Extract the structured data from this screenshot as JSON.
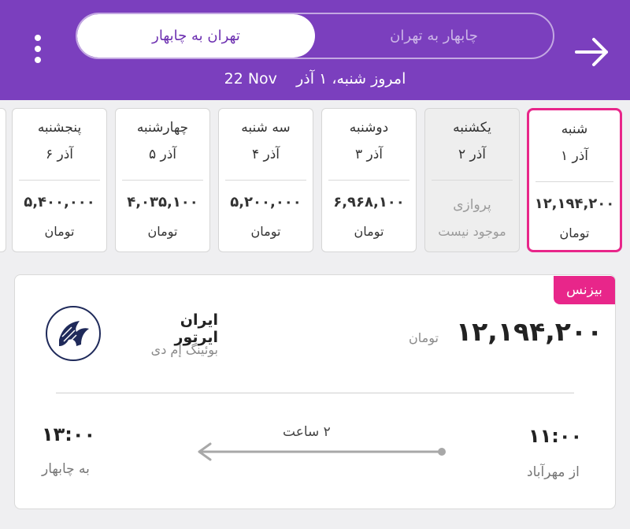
{
  "header": {
    "tabs": [
      {
        "label": "تهران به چابهار",
        "active": true
      },
      {
        "label": "چابهار به تهران",
        "active": false
      }
    ],
    "date_persian": "امروز شنبه، ۱ آذر",
    "date_gregorian": "22 Nov",
    "menu_icon": "more-vertical-icon",
    "back_icon": "arrow-right-icon",
    "color": "#7b3fbe"
  },
  "days": [
    {
      "day": "شنبه",
      "date": "۱ آذر",
      "price": "۱۲,۱۹۴,۲۰۰",
      "currency": "تومان",
      "selected": true
    },
    {
      "day": "یکشنبه",
      "date": "۲ آذر",
      "unavailable_line1": "پروازی",
      "unavailable_line2": "موجود نیست"
    },
    {
      "day": "دوشنبه",
      "date": "۳ آذر",
      "price": "۶,۹۶۸,۱۰۰",
      "currency": "تومان"
    },
    {
      "day": "سه شنبه",
      "date": "۴ آذر",
      "price": "۵,۲۰۰,۰۰۰",
      "currency": "تومان"
    },
    {
      "day": "چهارشنبه",
      "date": "۵ آذر",
      "price": "۴,۰۳۵,۱۰۰",
      "currency": "تومان"
    },
    {
      "day": "پنجشنبه",
      "date": "۶ آذر",
      "price": "۵,۴۰۰,۰۰۰",
      "currency": "تومان"
    }
  ],
  "flight": {
    "class_badge": "بیزنس",
    "airline": "ایران ایرتور",
    "aircraft": "بوئینگ إم دی",
    "price": "۱۲,۱۹۴,۲۰۰",
    "currency": "تومان",
    "depart_time": "۱۱:۰۰",
    "depart_from": "از مهرآباد",
    "arrive_time": "۱۳:۰۰",
    "arrive_to": "به چابهار",
    "duration": "۲ ساعت",
    "logo_icon": "airline-logo-icon",
    "accent": "#e8268a"
  }
}
